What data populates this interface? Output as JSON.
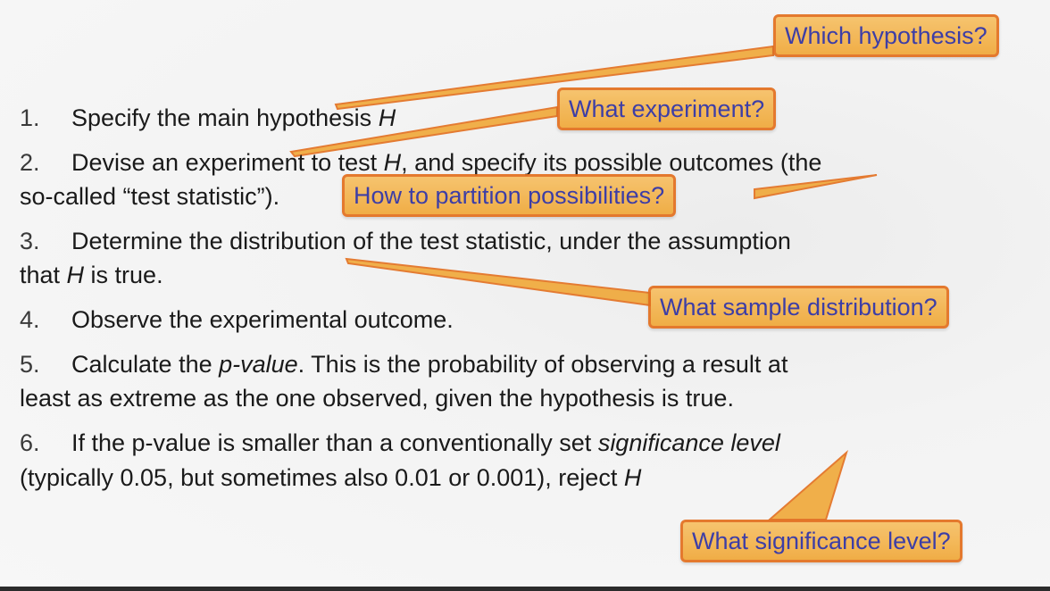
{
  "steps": [
    {
      "num": "1.",
      "line1_pre": "Specify the main hypothesis ",
      "line1_var": "H"
    },
    {
      "num": "2.",
      "line1_pre": "Devise an experiment to test ",
      "line1_var": "H",
      "line1_post": ", and specify its possible outcomes (the",
      "line2": "so-called “test statistic”)."
    },
    {
      "num": "3.",
      "line1": "Determine the distribution of the test statistic, under the assumption",
      "line2_pre": "that ",
      "line2_var": "H",
      "line2_post": " is true."
    },
    {
      "num": "4.",
      "line1": "Observe the experimental outcome."
    },
    {
      "num": "5.",
      "line1_pre": "Calculate the ",
      "line1_em": "p-value",
      "line1_post": ". This is the probability of observing a result at",
      "line2": "least as extreme as the one observed, given the hypothesis is true."
    },
    {
      "num": "6.",
      "line1_pre": "If the p-value is smaller than a conventionally set ",
      "line1_em": "significance level",
      "line2_pre": "(typically 0.05, but sometimes also 0.01 or 0.001), reject ",
      "line2_var": "H"
    }
  ],
  "callouts": {
    "which_hypothesis": "Which hypothesis?",
    "what_experiment": "What experiment?",
    "partition": "How to partition possibilities?",
    "sample_distribution": "What sample distribution?",
    "significance_level": "What significance level?"
  },
  "colors": {
    "callout_fill": "#f3b24c",
    "callout_border": "#e36f1e",
    "callout_text": "#2e2fa0",
    "body_text": "#3a3a3a"
  }
}
